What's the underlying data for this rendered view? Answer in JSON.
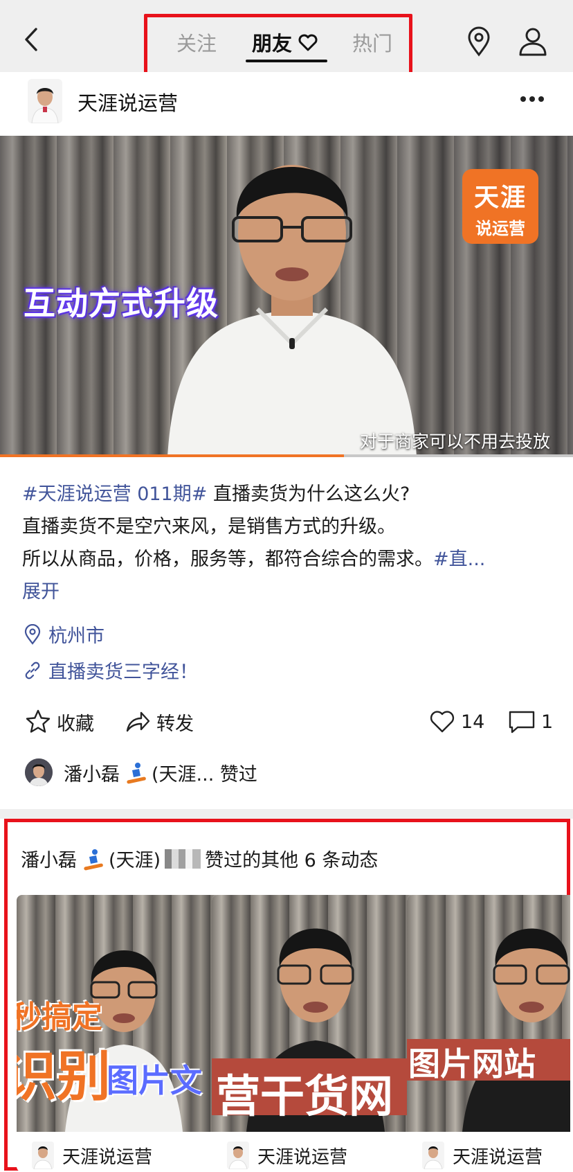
{
  "nav": {
    "tabs": [
      {
        "label": "关注"
      },
      {
        "label": "朋友"
      },
      {
        "label": "热门"
      }
    ]
  },
  "author": {
    "name": "天涯说运营"
  },
  "video": {
    "logo_line1": "天涯",
    "logo_line2": "说运营",
    "headline": "互动方式升级",
    "subtitle": "对于商家可以不用去投放",
    "progress": 0.6
  },
  "post": {
    "tag": "#天涯说运营 011期#",
    "line1_text": " 直播卖货为什么这么火?",
    "line2": "直播卖货不是空穴来风，是销售方式的升级。",
    "line3_text": "所以从商品，价格，服务等，都符合综合的需求。",
    "line3_tag": "#直...",
    "expand": "展开"
  },
  "location": "杭州市",
  "link": "直播卖货三字经！",
  "actions": {
    "favorite": "收藏",
    "share": "转发",
    "likes": "14",
    "comments": "1"
  },
  "liked_by": {
    "name": "潘小磊",
    "tail": "(天涯... 赞过"
  },
  "related": {
    "title_prefix": "潘小磊",
    "title_mid": "(天涯)",
    "title_suffix": "赞过的其他 6 条动态",
    "items": [
      {
        "caption_top": "秒搞定",
        "caption_big": "识别",
        "caption_side": "图片文",
        "author": "天涯说运营"
      },
      {
        "caption_big": "营干货网",
        "author": "天涯说运营"
      },
      {
        "caption_big": "图片网站",
        "author": "天涯说运营"
      }
    ]
  },
  "colors": {
    "accent_link": "#41549a",
    "highlight_box": "#e8121b",
    "brand_orange": "#f07325"
  }
}
